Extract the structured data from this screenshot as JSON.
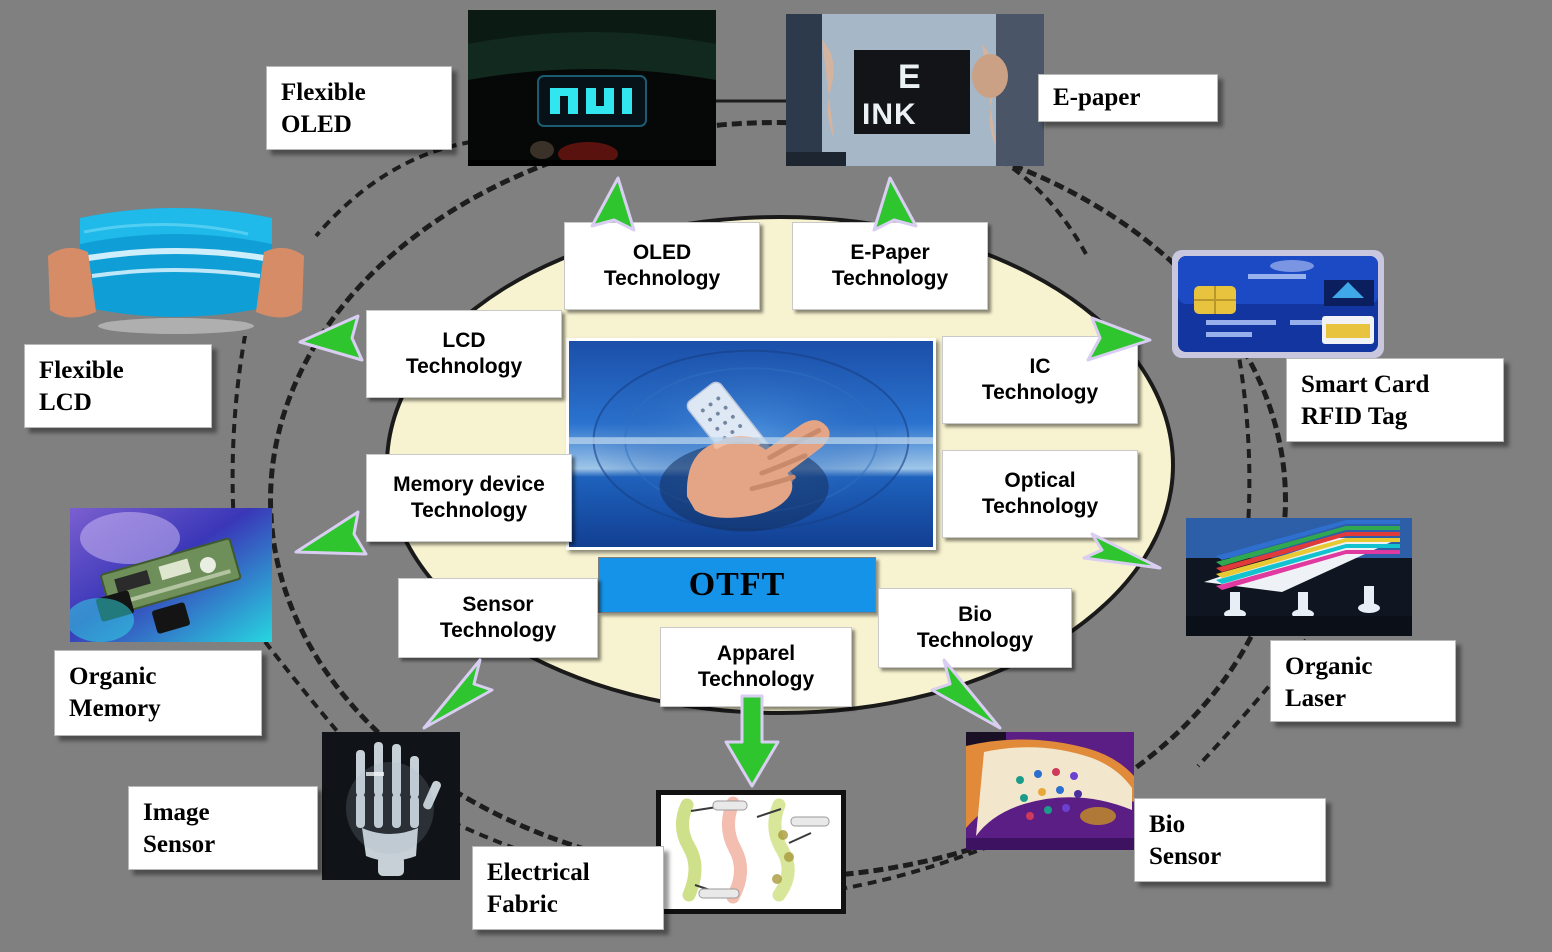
{
  "figure": {
    "background_color": "#808080",
    "center_label": "OTFT",
    "center_label_bg": "#1593e8",
    "inner_ring_fill": "#f7f2cf",
    "arrow_color": "#2fc52f"
  },
  "technologies": [
    {
      "id": "oled",
      "line1": "OLED",
      "line2": "Technology"
    },
    {
      "id": "epaper",
      "line1": "E-Paper",
      "line2": "Technology"
    },
    {
      "id": "lcd",
      "line1": "LCD",
      "line2": "Technology"
    },
    {
      "id": "ic",
      "line1": "IC",
      "line2": "Technology"
    },
    {
      "id": "memory",
      "line1": "Memory device",
      "line2": "Technology"
    },
    {
      "id": "optical",
      "line1": "Optical",
      "line2": "Technology"
    },
    {
      "id": "sensor",
      "line1": "Sensor",
      "line2": "Technology"
    },
    {
      "id": "bio",
      "line1": "Bio",
      "line2": "Technology"
    },
    {
      "id": "apparel",
      "line1": "Apparel",
      "line2": "Technology"
    }
  ],
  "applications": [
    {
      "id": "flexible-oled",
      "line1": "Flexible",
      "line2": "OLED"
    },
    {
      "id": "e-paper",
      "line1": "E-paper",
      "line2": ""
    },
    {
      "id": "flexible-lcd",
      "line1": "Flexible",
      "line2": "LCD"
    },
    {
      "id": "smart-card",
      "line1": "Smart Card",
      "line2": "RFID Tag"
    },
    {
      "id": "organic-memory",
      "line1": "Organic",
      "line2": "Memory"
    },
    {
      "id": "organic-laser",
      "line1": "Organic",
      "line2": "Laser"
    },
    {
      "id": "image-sensor",
      "line1": "Image",
      "line2": "Sensor"
    },
    {
      "id": "bio-sensor",
      "line1": "Bio",
      "line2": "Sensor"
    },
    {
      "id": "electrical-fabric",
      "line1": "Electrical",
      "line2": "Fabric"
    }
  ],
  "images": [
    {
      "id": "flexible-oled-photo",
      "alt": "flexible OLED display glowing cyan in a dark scene"
    },
    {
      "id": "e-ink-photo",
      "alt": "hands holding an E INK electronic paper sign"
    },
    {
      "id": "flexible-lcd-photo",
      "alt": "hands bending a blue flexible LCD panel"
    },
    {
      "id": "smart-card-photo",
      "alt": "blue smart card with gold chip"
    },
    {
      "id": "organic-memory-photo",
      "alt": "circuit board memory module on purple background"
    },
    {
      "id": "organic-laser-photo",
      "alt": "organic laser device emitting colored stripes"
    },
    {
      "id": "image-sensor-photo",
      "alt": "x-ray image of a human hand"
    },
    {
      "id": "bio-sensor-photo",
      "alt": "flexible bio sensor strip with colored dots"
    },
    {
      "id": "electrical-fabric-photo",
      "alt": "electrical fabric fibers diagram"
    },
    {
      "id": "otft-center-photo",
      "alt": "hand holding a flexible rolled display over a blue background"
    }
  ]
}
